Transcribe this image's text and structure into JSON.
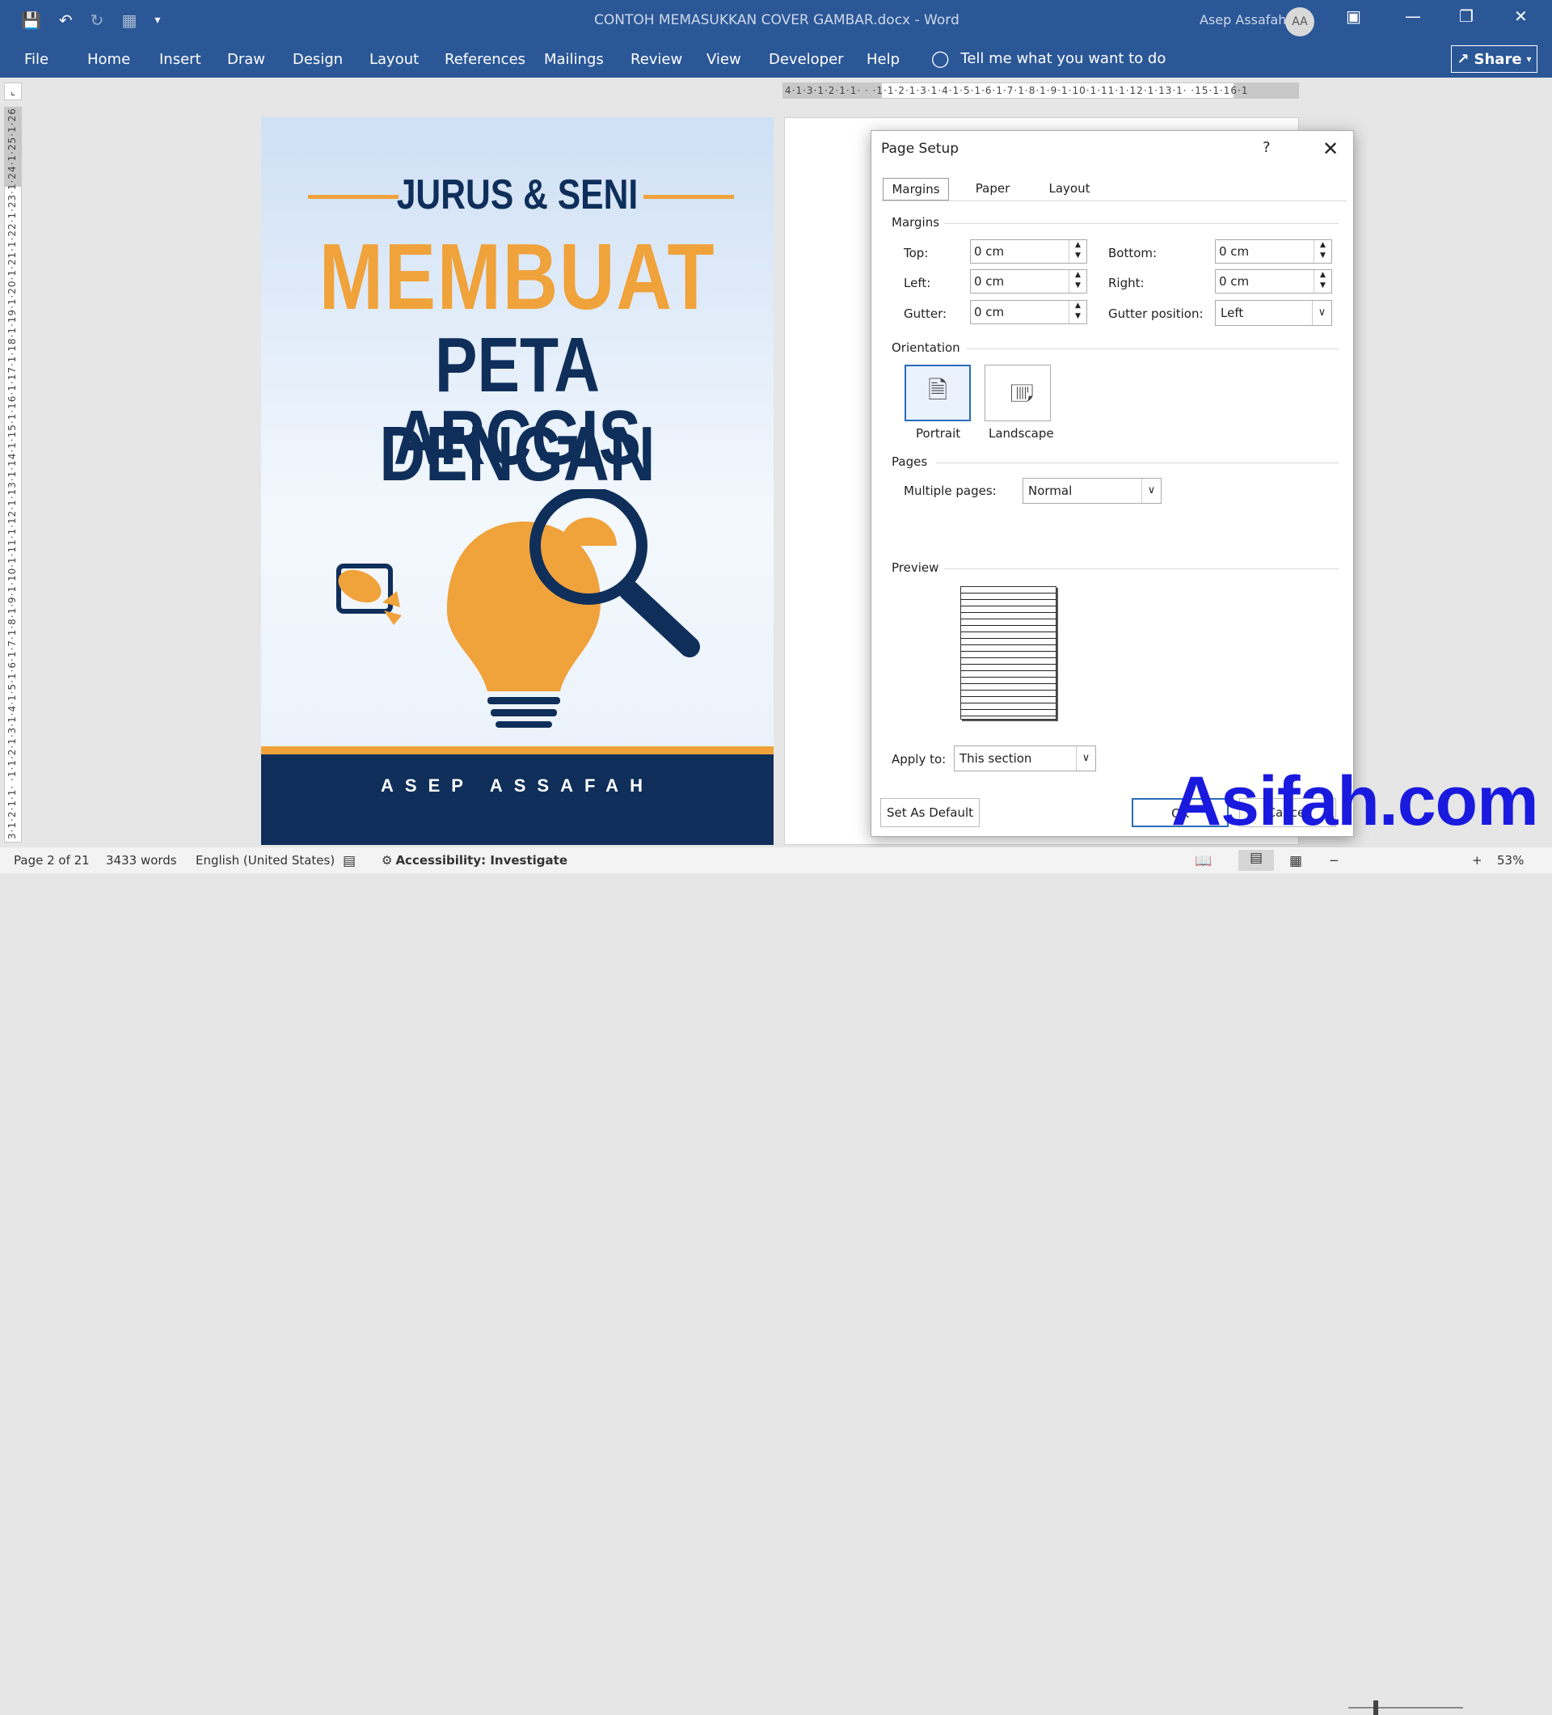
{
  "window": {
    "title": "CONTOH MEMASUKKAN COVER GAMBAR.docx  -  Word",
    "user": "Asep Assafah",
    "avatar": "AA"
  },
  "qat": {
    "icons": [
      "save-icon",
      "undo-icon",
      "redo-icon",
      "table-icon",
      "customize-icon"
    ]
  },
  "ribbon": {
    "tabs": [
      "File",
      "Home",
      "Insert",
      "Draw",
      "Design",
      "Layout",
      "References",
      "Mailings",
      "Review",
      "View",
      "Developer",
      "Help"
    ],
    "tell_me": "Tell me what you want to do",
    "share": "Share"
  },
  "ruler": {
    "horizontal": "4·1·3·1·2·1·1· · ·1·1·2·1·3·1·4·1·5·1·6·1·7·1·8·1·9·1·10·1·11·1·12·1·13·1· ·15·1·16·1",
    "vertical": "3·1·2·1·1· ·1·1·2·1·3·1·4·1·5·1·6·1·7·1·8·1·9·1·10·1·11·1·12·1·13·1·14·1·15·1·16·1·17·1·18·1·19·1·20·1·21·1·22·1·23·1·24·1·25·1·26·1"
  },
  "cover": {
    "line1": "JURUS & SENI",
    "line2": "MEMBUAT",
    "line3": "PETA DENGAN",
    "line4": "ARCGIS",
    "author": "ASEP ASSAFAH",
    "colors": {
      "navy": "#0f2f5a",
      "orange": "#f0a23b"
    }
  },
  "dialog": {
    "title": "Page Setup",
    "help": "?",
    "tabs": [
      "Margins",
      "Paper",
      "Layout"
    ],
    "margins_section": "Margins",
    "top_label": "Top:",
    "top_value": "0 cm",
    "bottom_label": "Bottom:",
    "bottom_value": "0 cm",
    "left_label": "Left:",
    "left_value": "0 cm",
    "right_label": "Right:",
    "right_value": "0 cm",
    "gutter_label": "Gutter:",
    "gutter_value": "0 cm",
    "gutter_pos_label": "Gutter position:",
    "gutter_pos_value": "Left",
    "orientation_section": "Orientation",
    "portrait": "Portrait",
    "landscape": "Landscape",
    "pages_section": "Pages",
    "multiple_pages_label": "Multiple pages:",
    "multiple_pages_value": "Normal",
    "preview_section": "Preview",
    "apply_to_label": "Apply to:",
    "apply_to_value": "This section",
    "set_default": "Set As Default",
    "ok": "OK",
    "cancel": "Cancel"
  },
  "status": {
    "page": "Page 2 of 21",
    "words": "3433 words",
    "language": "English (United States)",
    "accessibility": "Accessibility: Investigate",
    "zoom": "53%",
    "zoom_fraction": 0.53
  },
  "watermark": "Asifah.com"
}
